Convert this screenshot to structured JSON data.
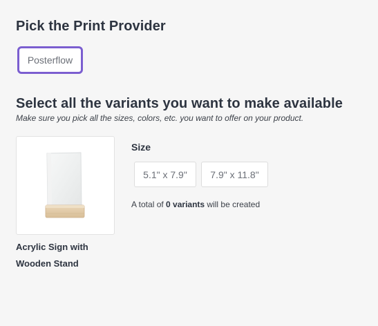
{
  "provider_section": {
    "title": "Pick the Print Provider",
    "selected_provider": "Posterflow"
  },
  "variants_section": {
    "title": "Select all the variants you want to make available",
    "subtitle": "Make sure you pick all the sizes, colors, etc. you want to offer on your product."
  },
  "product": {
    "name": "Acrylic Sign with Wooden Stand",
    "image_icon": "acrylic-sign-product-image"
  },
  "size": {
    "label": "Size",
    "options": [
      "5.1\" x 7.9\"",
      "7.9\" x 11.8\""
    ]
  },
  "summary": {
    "prefix": "A total of ",
    "count": "0 variants",
    "suffix": " will be created"
  },
  "colors": {
    "accent": "#7b5ed0",
    "text": "#2d3440",
    "background": "#f6f6f6"
  }
}
